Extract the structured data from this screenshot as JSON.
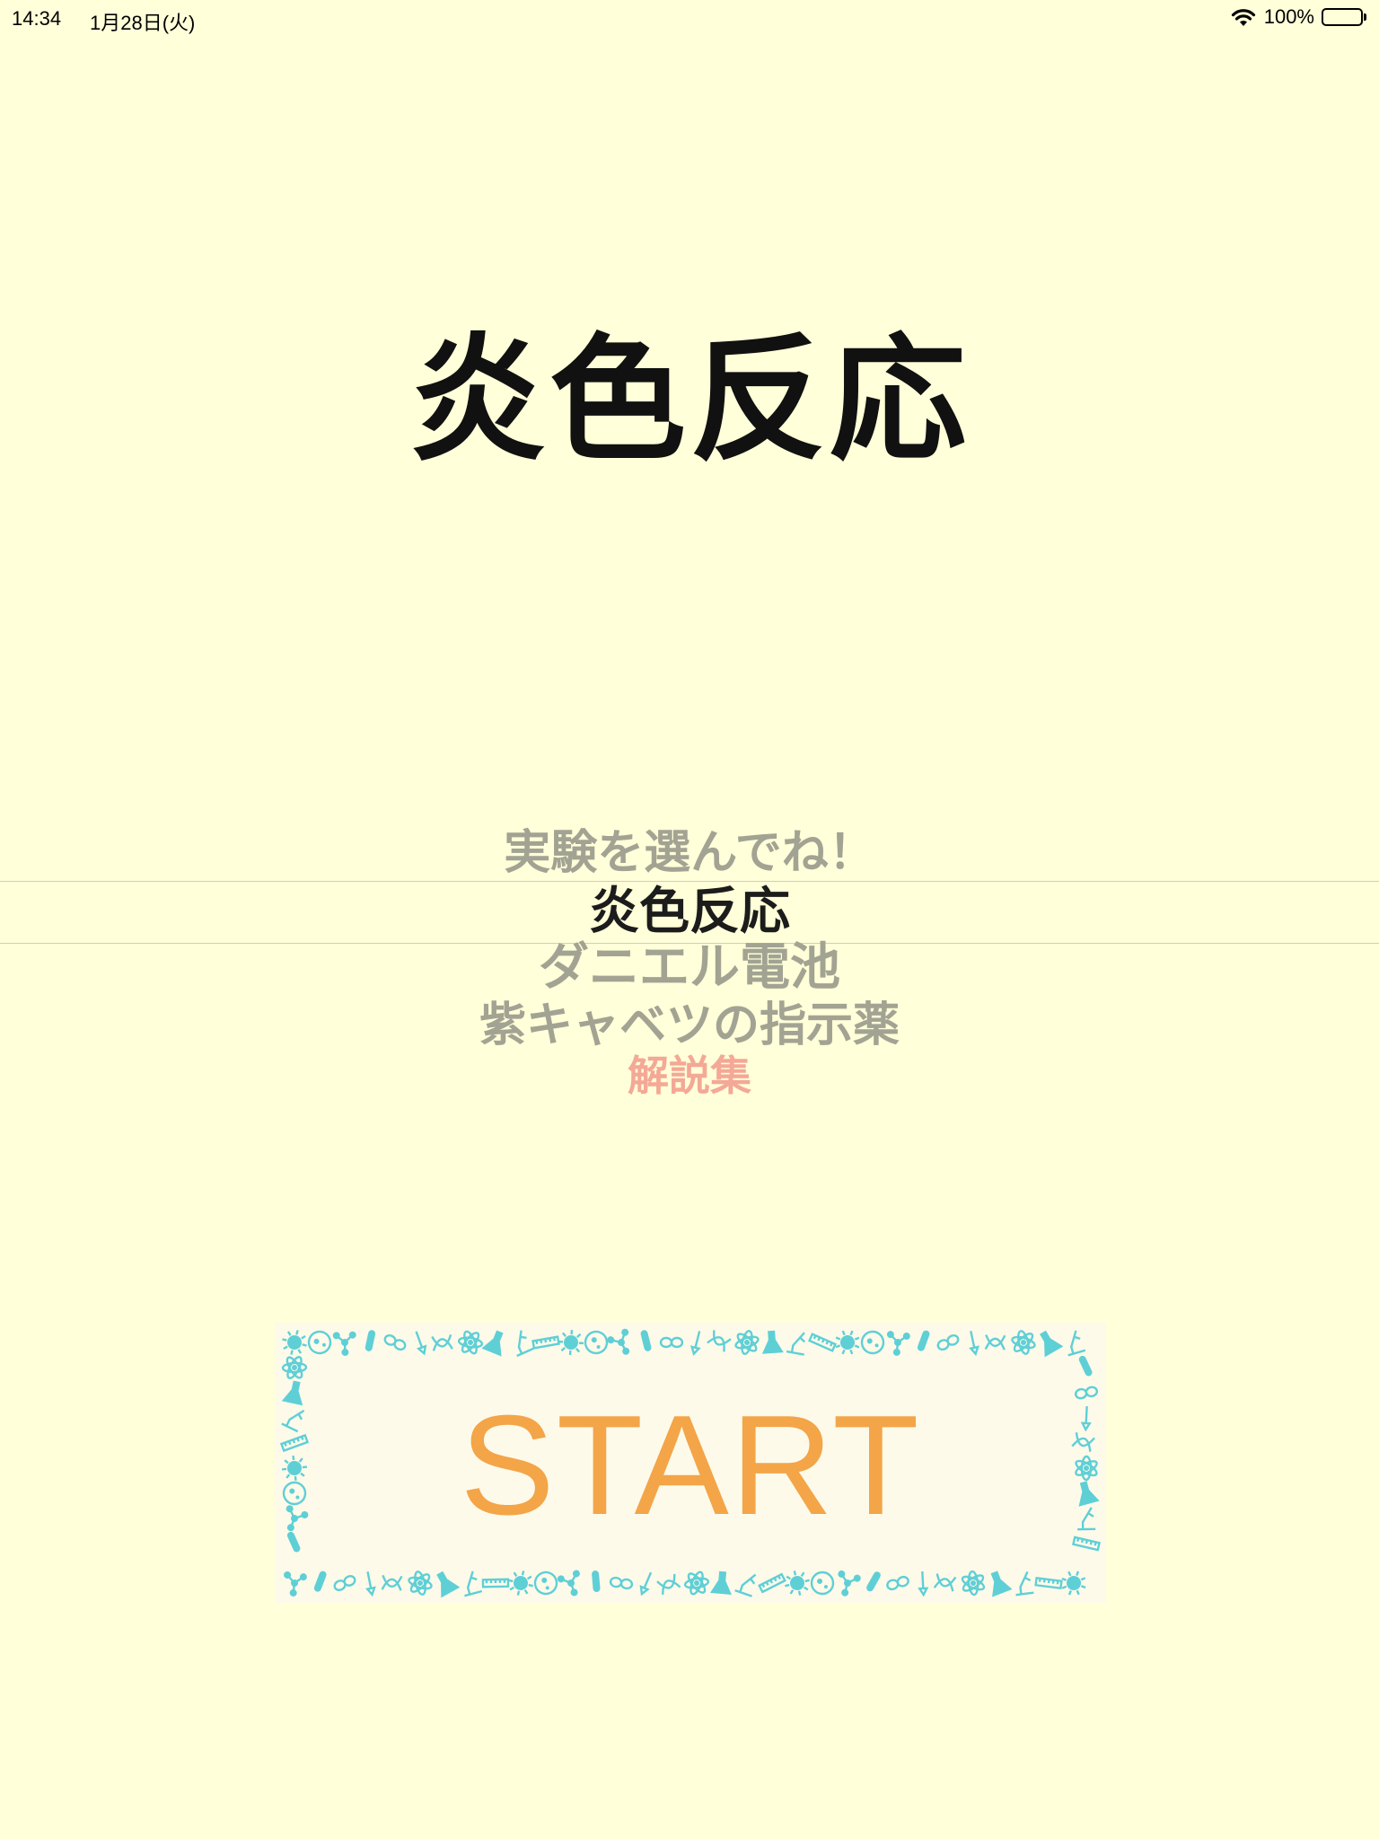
{
  "status_bar": {
    "time": "14:34",
    "date": "1月28日(火)",
    "battery_percent_label": "100%",
    "battery_level": 1.0
  },
  "title": "炎色反応",
  "picker": {
    "items": [
      "実験を選んでね！",
      "炎色反応",
      "ダニエル電池",
      "紫キャベツの指示薬",
      "解説集"
    ],
    "selected_index": 1
  },
  "start_button": {
    "label": "START",
    "frame_icons": [
      "virus-icon",
      "dna-icon",
      "cell-icon",
      "atom-icon",
      "molecule-icon",
      "flask-icon",
      "test-tube-icon",
      "microscope-icon",
      "goggles-icon",
      "ruler-icon",
      "pipette-icon"
    ]
  },
  "colors": {
    "background": "#ffffd9",
    "title_text": "#111111",
    "picker_selected": "#1c1c1c",
    "picker_unselected": "#a3a393",
    "picker_highlight": "#f4a896",
    "start_text": "#f3a548",
    "frame_icon": "#5fcfd6"
  }
}
